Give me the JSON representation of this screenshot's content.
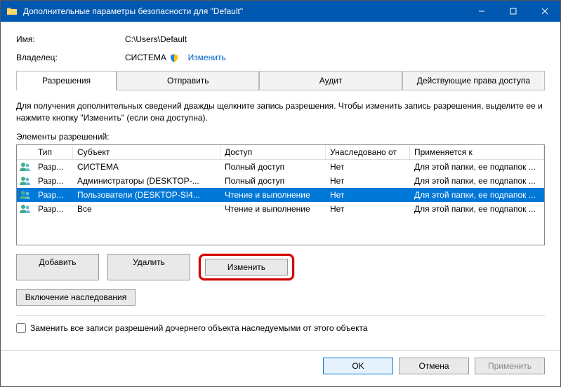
{
  "titlebar": {
    "text": "Дополнительные параметры безопасности  для \"Default\""
  },
  "info": {
    "name_label": "Имя:",
    "name_value": "C:\\Users\\Default",
    "owner_label": "Владелец:",
    "owner_value": "СИСТЕМА",
    "change_link": "Изменить"
  },
  "tabs": {
    "permissions": "Разрешения",
    "share": "Отправить",
    "audit": "Аудит",
    "effective": "Действующие права доступа"
  },
  "instructions": "Для получения дополнительных сведений дважды щелкните запись разрешения. Чтобы изменить запись разрешения, выделите ее и нажмите кнопку \"Изменить\" (если она доступна).",
  "list_label": "Элементы разрешений:",
  "columns": {
    "type": "Тип",
    "subject": "Субъект",
    "access": "Доступ",
    "inherit": "Унаследовано от",
    "apply": "Применяется к"
  },
  "rows": [
    {
      "type": "Разр...",
      "subject": "СИСТЕМА",
      "access": "Полный доступ",
      "inherit": "Нет",
      "apply": "Для этой папки, ее подпапок ..."
    },
    {
      "type": "Разр...",
      "subject": "Администраторы (DESKTOP-...",
      "access": "Полный доступ",
      "inherit": "Нет",
      "apply": "Для этой папки, ее подпапок ..."
    },
    {
      "type": "Разр...",
      "subject": "Пользователи (DESKTOP-SI4...",
      "access": "Чтение и выполнение",
      "inherit": "Нет",
      "apply": "Для этой папки, ее подпапок ..."
    },
    {
      "type": "Разр...",
      "subject": "Все",
      "access": "Чтение и выполнение",
      "inherit": "Нет",
      "apply": "Для этой папки, ее подпапок ..."
    }
  ],
  "selected_row_index": 2,
  "buttons": {
    "add": "Добавить",
    "remove": "Удалить",
    "edit": "Изменить",
    "enable_inherit": "Включение наследования"
  },
  "checkbox_label": "Заменить все записи разрешений дочернего объекта наследуемыми от этого объекта",
  "footer": {
    "ok": "OK",
    "cancel": "Отмена",
    "apply": "Применить"
  }
}
